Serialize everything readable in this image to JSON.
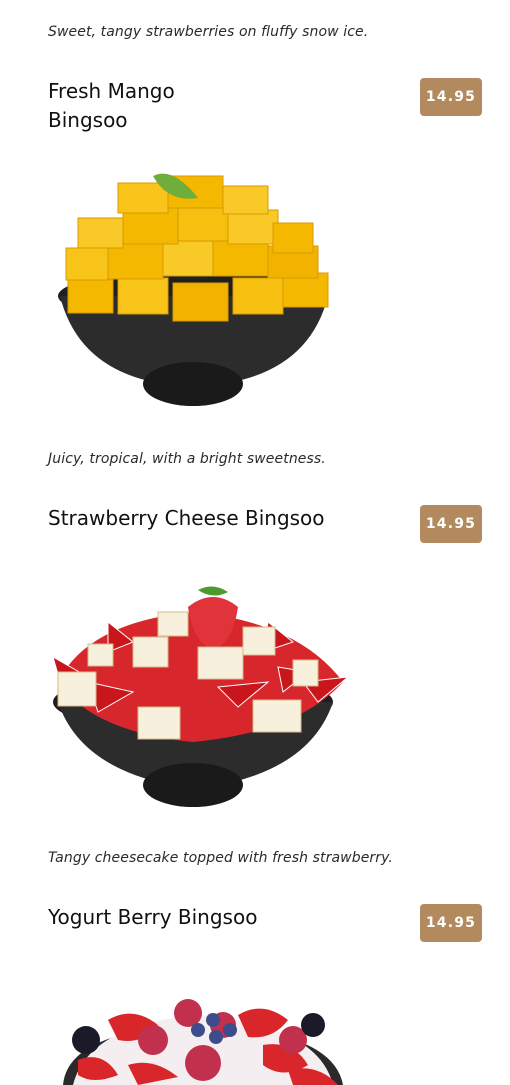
{
  "items": [
    {
      "description": "Sweet, tangy strawberries on fluffy snow ice."
    },
    {
      "title_line1": "Fresh Mango",
      "title_line2": "Bingsoo",
      "price": "14.95",
      "description": "Juicy, tropical, with a bright sweetness.",
      "image_icon": "mango-bingsoo-photo"
    },
    {
      "title": "Strawberry Cheese Bingsoo",
      "price": "14.95",
      "description": "Tangy cheesecake topped with fresh strawberry.",
      "image_icon": "strawberry-cheese-bingsoo-photo"
    },
    {
      "title": "Yogurt Berry Bingsoo",
      "price": "14.95",
      "image_icon": "yogurt-berry-bingsoo-photo"
    }
  ],
  "colors": {
    "price_badge": "#b28a5e",
    "bowl": "#2a2a2a",
    "mango": "#f5b800",
    "strawberry": "#d9262b"
  }
}
